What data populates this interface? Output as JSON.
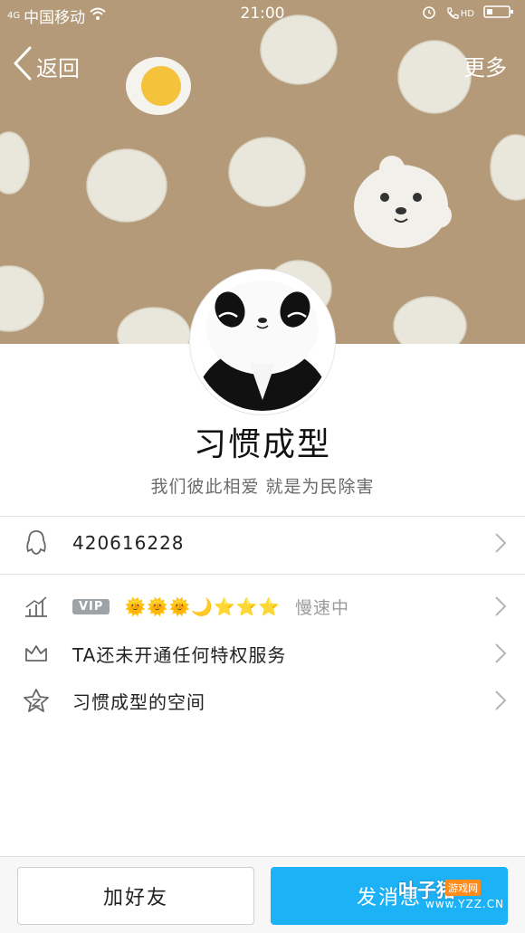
{
  "status": {
    "carrier": "中国移动",
    "time": "21:00",
    "network": "4G",
    "hd": "HD"
  },
  "nav": {
    "back": "返回",
    "more": "更多"
  },
  "profile": {
    "nickname": "习惯成型",
    "signature": "我们彼此相爱 就是为民除害"
  },
  "rows": {
    "qq_number": "420616228",
    "vip_badge": "VIP",
    "vip_levels": "🌞🌞🌞🌙⭐⭐⭐",
    "vip_speed": "慢速中",
    "privilege": "TA还未开通任何特权服务",
    "space": "习惯成型的空间"
  },
  "actions": {
    "add_friend": "加好友",
    "send_message": "发消息"
  },
  "watermark": {
    "name": "叶子猪",
    "tag": "游戏网",
    "url": "www.YZZ.CN"
  },
  "colors": {
    "banner": "#b49a78",
    "accent": "#1db2f5"
  }
}
